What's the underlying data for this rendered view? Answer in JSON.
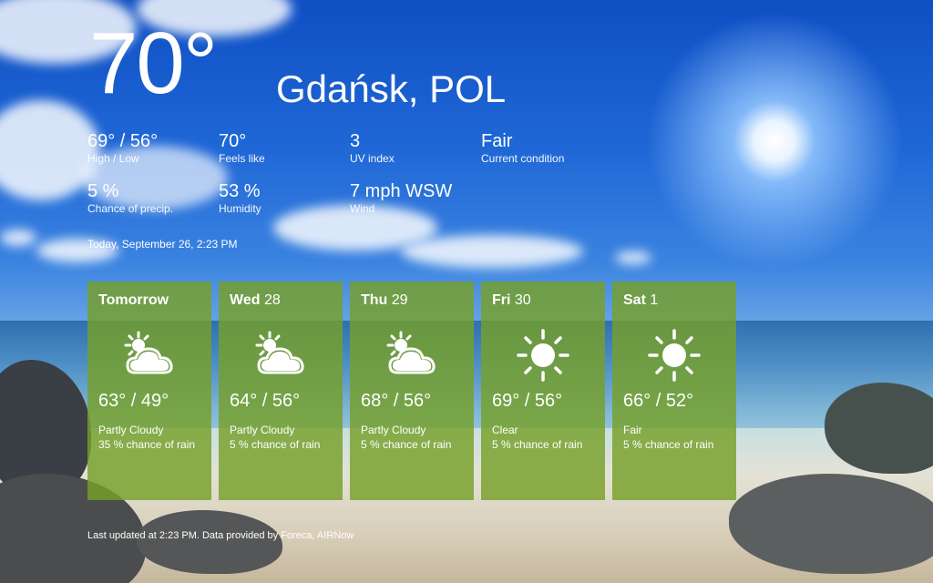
{
  "current": {
    "temperature": "70°",
    "location": "Gdańsk, POL",
    "stats": [
      {
        "value": "69° / 56°",
        "label": "High / Low"
      },
      {
        "value": "70°",
        "label": "Feels like"
      },
      {
        "value": "3",
        "label": "UV index"
      },
      {
        "value": "Fair",
        "label": "Current condition"
      },
      {
        "value": "5 %",
        "label": "Chance of precip."
      },
      {
        "value": "53 %",
        "label": "Humidity"
      },
      {
        "value": "7 mph WSW",
        "label": "Wind"
      }
    ],
    "timestamp": "Today, September 26, 2:23 PM"
  },
  "forecast": [
    {
      "day": "Tomorrow",
      "date": "",
      "icon": "partly-cloudy-icon",
      "high_low": "63° / 49°",
      "condition": "Partly Cloudy",
      "rain": "35 % chance of rain"
    },
    {
      "day": "Wed",
      "date": "28",
      "icon": "partly-cloudy-icon",
      "high_low": "64° / 56°",
      "condition": "Partly Cloudy",
      "rain": "5 % chance of rain"
    },
    {
      "day": "Thu",
      "date": "29",
      "icon": "partly-cloudy-icon",
      "high_low": "68° / 56°",
      "condition": "Partly Cloudy",
      "rain": "5 % chance of rain"
    },
    {
      "day": "Fri",
      "date": "30",
      "icon": "sun-icon",
      "high_low": "69° / 56°",
      "condition": "Clear",
      "rain": "5 % chance of rain"
    },
    {
      "day": "Sat",
      "date": "1",
      "icon": "sun-icon",
      "high_low": "66° / 52°",
      "condition": "Fair",
      "rain": "5 % chance of rain"
    }
  ],
  "footer": "Last updated at 2:23 PM. Data provided by Foreca, AIRNow",
  "colors": {
    "tile": "#76a028",
    "text": "#ffffff"
  }
}
